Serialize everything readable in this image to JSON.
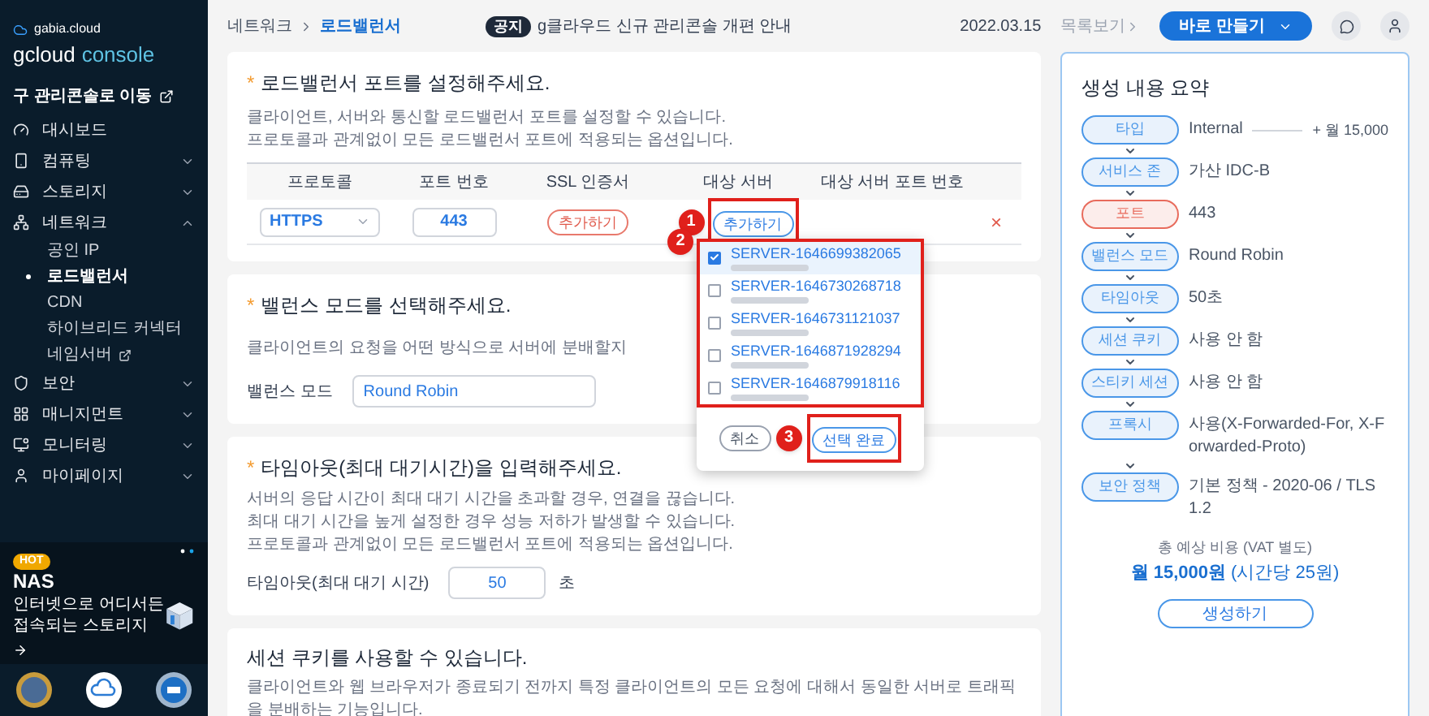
{
  "sidebar": {
    "brand_small": "gabia.cloud",
    "brand": "gcloud",
    "brand_suffix": "console",
    "legacy_link": "구 관리콘솔로 이동",
    "items": [
      {
        "kind": "link",
        "label": "대시보드"
      },
      {
        "kind": "group",
        "label": "컴퓨팅",
        "expanded": false
      },
      {
        "kind": "group",
        "label": "스토리지",
        "expanded": false
      },
      {
        "kind": "group",
        "label": "네트워크",
        "expanded": true,
        "children": [
          {
            "label": "공인 IP",
            "selected": false,
            "external": false
          },
          {
            "label": "로드밸런서",
            "selected": true,
            "external": false
          },
          {
            "label": "CDN",
            "selected": false,
            "external": false
          },
          {
            "label": "하이브리드 커넥터",
            "selected": false,
            "external": false
          },
          {
            "label": "네임서버",
            "selected": false,
            "external": true
          }
        ]
      },
      {
        "kind": "group",
        "label": "보안",
        "expanded": false
      },
      {
        "kind": "group",
        "label": "매니지먼트",
        "expanded": false
      },
      {
        "kind": "group",
        "label": "모니터링",
        "expanded": false
      },
      {
        "kind": "group",
        "label": "마이페이지",
        "expanded": false
      }
    ],
    "banner": {
      "badge": "HOT",
      "title": "NAS",
      "lines": [
        "인터넷으로 어디서든",
        "접속되는 스토리지"
      ]
    }
  },
  "topbar": {
    "breadcrumb": [
      "네트워크",
      "로드밸런서"
    ],
    "notice_tag": "공지",
    "notice": "g클라우드 신규 관리콘솔 개편 안내",
    "date": "2022.03.15",
    "more": "목록보기",
    "create_button": "바로 만들기"
  },
  "port_card": {
    "required_mark": "*",
    "title": "로드밸런서 포트를 설정해주세요.",
    "description": [
      "클라이언트, 서버와 통신할 로드밸런서 포트를 설정할 수 있습니다.",
      "프로토콜과 관계없이 모든 로드밸런서 포트에 적용되는 옵션입니다."
    ],
    "columns": [
      "프로토콜",
      "포트 번호",
      "SSL 인증서",
      "대상 서버",
      "대상 서버 포트 번호"
    ],
    "row": {
      "protocol": "HTTPS",
      "port": "443",
      "ssl_button": "추가하기",
      "target_button": "추가하기",
      "delete": "×"
    },
    "server_dropdown": {
      "items": [
        {
          "name": "SERVER-1646699382065",
          "checked": true
        },
        {
          "name": "SERVER-1646730268718",
          "checked": false
        },
        {
          "name": "SERVER-1646731121037",
          "checked": false
        },
        {
          "name": "SERVER-1646871928294",
          "checked": false
        },
        {
          "name": "SERVER-1646879918116",
          "checked": false
        }
      ],
      "cancel": "취소",
      "confirm": "선택 완료"
    }
  },
  "annotations": [
    "1",
    "2",
    "3"
  ],
  "balance_card": {
    "required_mark": "*",
    "title": "밸런스 모드를 선택해주세요.",
    "description": "클라이언트의 요청을 어떤 방식으로 서버에 분배할지",
    "field_label": "밸런스 모드",
    "value": "Round Robin"
  },
  "timeout_card": {
    "required_mark": "*",
    "title": "타임아웃(최대 대기시간)을 입력해주세요.",
    "description": [
      "서버의 응답 시간이 최대 대기 시간을 초과할 경우, 연결을 끊습니다.",
      "최대 대기 시간을 높게 설정한 경우 성능 저하가 발생할 수 있습니다.",
      "프로토콜과 관계없이 모든 로드밸런서 포트에 적용되는 옵션입니다."
    ],
    "field_label": "타임아웃(최대 대기 시간)",
    "value": "50",
    "unit": "초"
  },
  "cookie_card": {
    "title": "세션 쿠키를 사용할 수 있습니다.",
    "description": "클라이언트와 웹 브라우저가 종료되기 전까지 특정 클라이언트의 모든 요청에 대해서 동일한 서버로 트래픽을 분배하는 기능입니다."
  },
  "summary": {
    "title": "생성 내용 요약",
    "steps": [
      {
        "label": "타입",
        "value": "Internal",
        "extra": "+ 월 15,000",
        "color": "#4a97e8"
      },
      {
        "label": "서비스 존",
        "value": "가산 IDC-B",
        "color": "#4a97e8"
      },
      {
        "label": "포트",
        "value": "443",
        "color": "#e86b5c"
      },
      {
        "label": "밸런스 모드",
        "value": "Round Robin",
        "color": "#4a97e8"
      },
      {
        "label": "타임아웃",
        "value": "50초",
        "color": "#4a97e8"
      },
      {
        "label": "세션 쿠키",
        "value": "사용 안 함",
        "color": "#4a97e8"
      },
      {
        "label": "스티키 세션",
        "value": "사용 안 함",
        "color": "#4a97e8"
      },
      {
        "label": "프록시",
        "value": "사용(X-Forwarded-For, X-Forwarded-Proto)",
        "color": "#4a97e8"
      },
      {
        "label": "보안 정책",
        "value": "기본 정책 - 2020-06 / TLS 1.2",
        "color": "#4a97e8"
      }
    ],
    "cost_label": "총 예상 비용 (VAT 별도)",
    "cost": "**월 15,000원** (시간당 25원)",
    "create_button": "생성하기"
  }
}
